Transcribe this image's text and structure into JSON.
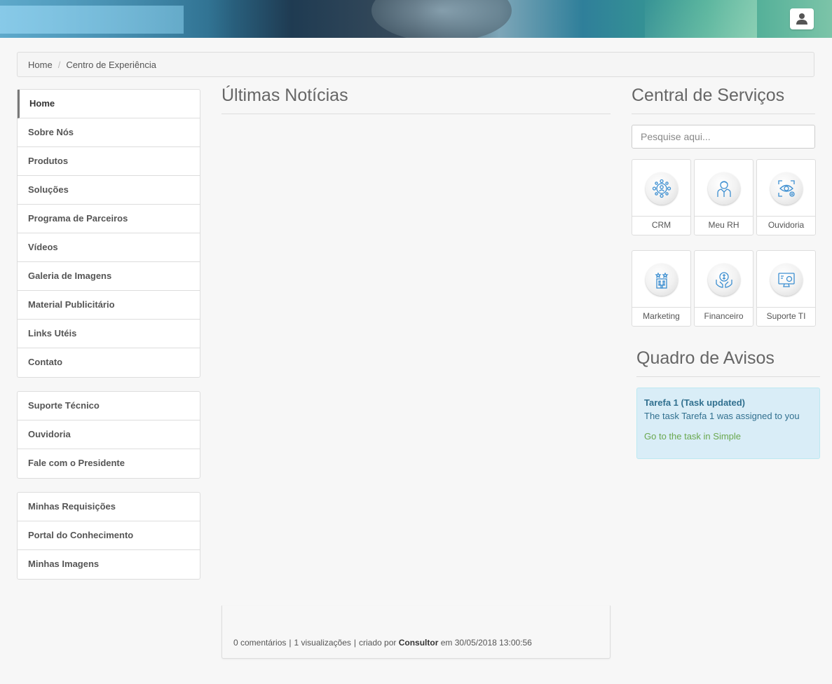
{
  "header": {
    "user_icon": "user-icon"
  },
  "breadcrumb": {
    "home": "Home",
    "separator": "/",
    "current": "Centro de Experiência"
  },
  "sidebar": {
    "group1": [
      "Home",
      "Sobre Nós",
      "Produtos",
      "Soluções",
      "Programa de Parceiros",
      "Vídeos",
      "Galeria de Imagens",
      "Material Publicitário",
      "Links Utéis",
      "Contato"
    ],
    "group2": [
      "Suporte Técnico",
      "Ouvidoria",
      "Fale com o Presidente"
    ],
    "group3": [
      "Minhas Requisições",
      "Portal do Conhecimento",
      "Minhas Imagens"
    ]
  },
  "news": {
    "title": "Últimas Notícias",
    "comments": "0 comentários",
    "views": "1 visualizações",
    "created_by_label": "criado por",
    "author": "Consultor",
    "date_label": "em 30/05/2018 13:00:56"
  },
  "services": {
    "title": "Central de Serviços",
    "search_placeholder": "Pesquise aqui...",
    "tiles": [
      {
        "label": "CRM",
        "icon": "crm-network-icon"
      },
      {
        "label": "Meu RH",
        "icon": "employee-icon"
      },
      {
        "label": "Ouvidoria",
        "icon": "eye-scan-icon"
      },
      {
        "label": "Marketing",
        "icon": "building-stars-icon"
      },
      {
        "label": "Financeiro",
        "icon": "money-hands-icon"
      },
      {
        "label": "Suporte TI",
        "icon": "monitor-support-icon"
      }
    ]
  },
  "notices": {
    "title": "Quadro de Avisos",
    "alert_title": "Tarefa 1 (Task updated)",
    "alert_body": "The task Tarefa 1 was assigned to you",
    "alert_link": "Go to the task in Simple"
  },
  "colors": {
    "alert_bg": "#d9edf7",
    "alert_text": "#31708f",
    "link_green": "#6aa84f",
    "icon_blue": "#3d8fd1"
  }
}
